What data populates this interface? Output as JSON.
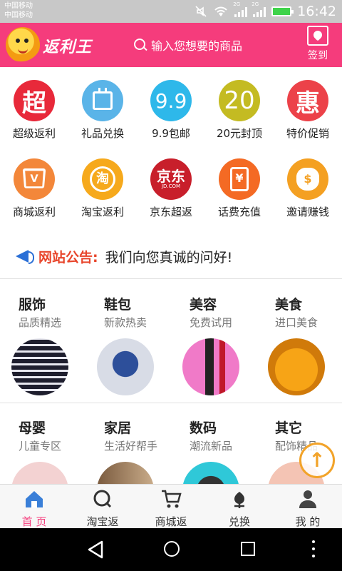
{
  "status_bar": {
    "carrier_1": "中国移动",
    "carrier_2": "中国移动",
    "network_1": "2G",
    "network_2": "2G",
    "time": "16:42"
  },
  "header": {
    "logo_text": "返利王",
    "search_placeholder": "输入您想要的商品",
    "checkin_label": "签到"
  },
  "grid": {
    "row1": [
      {
        "label": "超级返利",
        "glyph": "超",
        "color": "#e8293a",
        "icon": "super-rebate-icon"
      },
      {
        "label": "礼品兑换",
        "glyph": "",
        "color": "#5ab4e8",
        "icon": "calendar-icon"
      },
      {
        "label": "9.9包邮",
        "glyph": "9.9",
        "color": "#2eb8ea",
        "icon": "nine-nine-icon"
      },
      {
        "label": "20元封顶",
        "glyph": "20",
        "color": "#c4bb22",
        "icon": "twenty-icon"
      },
      {
        "label": "特价促销",
        "glyph": "惠",
        "color": "#ec4249",
        "icon": "discount-icon"
      }
    ],
    "row2": [
      {
        "label": "商城返利",
        "glyph": "V",
        "color": "#f3873a",
        "icon": "shopping-bag-icon"
      },
      {
        "label": "淘宝返利",
        "glyph": "淘",
        "color": "#f6a91c",
        "icon": "taobao-icon"
      },
      {
        "label": "京东超返",
        "glyph": "京东",
        "sub": "JD.COM",
        "color": "#c81f2b",
        "icon": "jd-icon"
      },
      {
        "label": "话费充值",
        "glyph": "¥",
        "color": "#f46a24",
        "icon": "phone-recharge-icon"
      },
      {
        "label": "邀请赚钱",
        "glyph": "$",
        "color": "#f4a022",
        "icon": "money-bag-icon"
      }
    ]
  },
  "notice": {
    "title": "网站公告:",
    "text": "我们向您真诚的问好!"
  },
  "categories": {
    "row1": [
      {
        "title": "服饰",
        "sub": "品质精选",
        "img": "clothing-image",
        "bg": "#3a3a4a"
      },
      {
        "title": "鞋包",
        "sub": "新款热卖",
        "img": "bags-image",
        "bg": "#d9dde8"
      },
      {
        "title": "美容",
        "sub": "免费试用",
        "img": "cosmetics-image",
        "bg": "#f07ac8"
      },
      {
        "title": "美食",
        "sub": "进口美食",
        "img": "food-image",
        "bg": "#f39a12"
      }
    ],
    "row2": [
      {
        "title": "母婴",
        "sub": "儿童专区",
        "img": "baby-image",
        "bg": "#f3c9c9"
      },
      {
        "title": "家居",
        "sub": "生活好帮手",
        "img": "home-image",
        "bg": "#b59b7e"
      },
      {
        "title": "数码",
        "sub": "潮流新品",
        "img": "digital-image",
        "bg": "#2fc8d8"
      },
      {
        "title": "其它",
        "sub": "配饰精品",
        "img": "other-image",
        "bg": "#f4c4b4"
      }
    ]
  },
  "tabbar": [
    {
      "label": "首 页",
      "icon": "home-icon",
      "active": true
    },
    {
      "label": "淘宝返",
      "icon": "taobao-tab-icon",
      "active": false
    },
    {
      "label": "商城返",
      "icon": "cart-icon",
      "active": false
    },
    {
      "label": "兑换",
      "icon": "exchange-icon",
      "active": false
    },
    {
      "label": "我 的",
      "icon": "profile-icon",
      "active": false
    }
  ],
  "colors": {
    "brand": "#f53c7c",
    "notice_title": "#e8452b",
    "float_button": "#f2a329"
  }
}
